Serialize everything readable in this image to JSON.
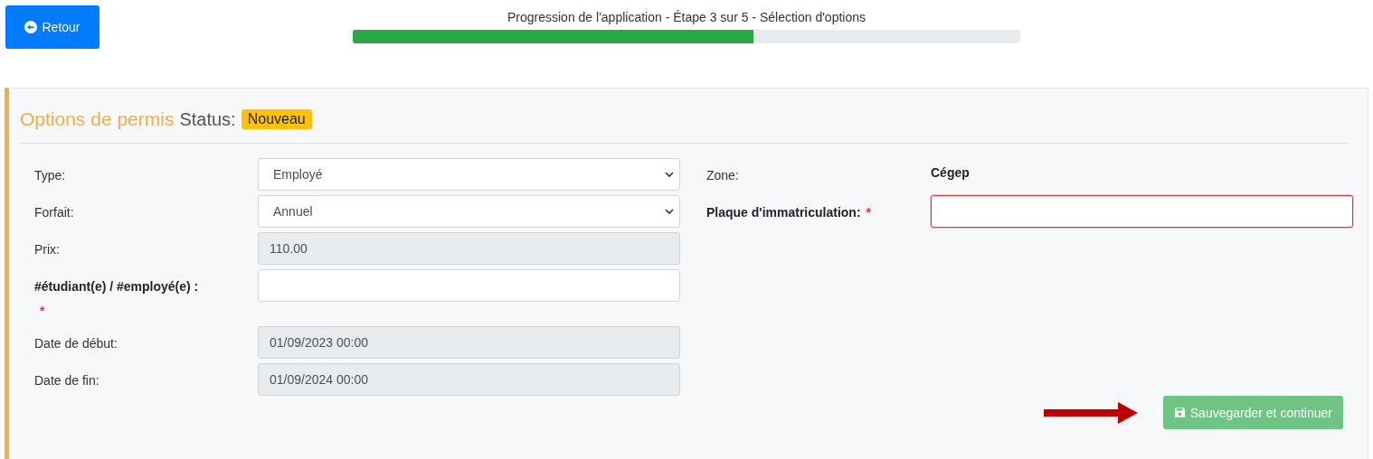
{
  "back_button": {
    "label": "Retour"
  },
  "progress": {
    "label": "Progression de l'application - Étape 3 sur 5 - Sélection d'options",
    "level": 0.6
  },
  "panel": {
    "title": "Options de permis",
    "status_label": "Status:",
    "status_badge": "Nouveau",
    "left_fields": [
      {
        "label": "Type:",
        "kind": "select",
        "value": "Employé",
        "required": false
      },
      {
        "label": "Forfait:",
        "kind": "select",
        "value": "Annuel",
        "required": false
      },
      {
        "label": "Prix:",
        "kind": "readonly",
        "value": "110.00",
        "required": false
      },
      {
        "label": "#étudiant(e) / #employé(e) :",
        "kind": "input",
        "required": true,
        "required_mark": "*",
        "invalid": false
      },
      {
        "label": "Date de début:",
        "kind": "readonly",
        "value": "01/09/2023 00:00",
        "required": false
      },
      {
        "label": "Date de fin:",
        "kind": "readonly",
        "value": "01/09/2024 00:00",
        "required": false
      }
    ],
    "right_fields": [
      {
        "label": "Zone:",
        "kind": "text",
        "value": "Cégep",
        "required": false
      },
      {
        "label": "Plaque d'immatriculation:",
        "kind": "input",
        "required": true,
        "required_mark": "*",
        "invalid": true
      }
    ],
    "save_button": {
      "label": "Sauvegarder et continuer",
      "disabled": true
    }
  }
}
